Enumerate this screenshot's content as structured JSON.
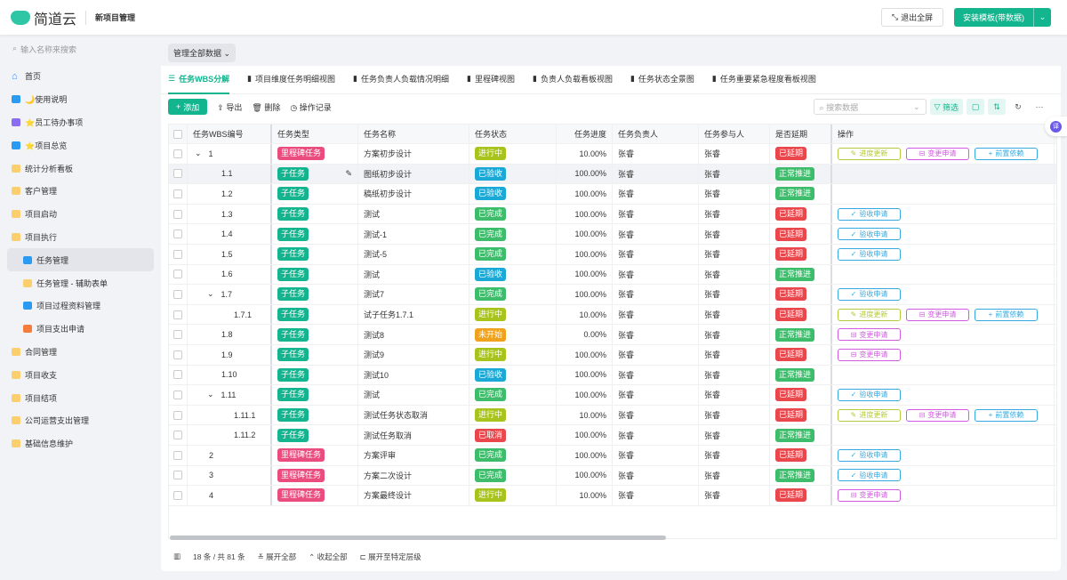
{
  "header": {
    "logo": "简道云",
    "app_title": "新项目管理",
    "exit_fullscreen": "退出全屏",
    "install": "安装模板(带数据)"
  },
  "sidebar": {
    "search_placeholder": "输入名称来搜索",
    "items": [
      {
        "label": "首页",
        "icon": "home",
        "level": 0
      },
      {
        "label": "🌙使用说明",
        "icon": "doc",
        "level": 0
      },
      {
        "label": "⭐员工待办事项",
        "icon": "chart",
        "level": 0
      },
      {
        "label": "⭐项目总览",
        "icon": "doc",
        "level": 0
      },
      {
        "label": "统计分析看板",
        "icon": "folder",
        "level": 0
      },
      {
        "label": "客户管理",
        "icon": "folder",
        "level": 0
      },
      {
        "label": "项目启动",
        "icon": "folder",
        "level": 0
      },
      {
        "label": "项目执行",
        "icon": "folder",
        "level": 0
      },
      {
        "label": "任务管理",
        "icon": "doc",
        "level": 1,
        "active": true
      },
      {
        "label": "任务管理 - 辅助表单",
        "icon": "folder",
        "level": 1
      },
      {
        "label": "项目过程资料管理",
        "icon": "doc",
        "level": 1
      },
      {
        "label": "项目支出申请",
        "icon": "orange",
        "level": 1
      },
      {
        "label": "合同管理",
        "icon": "folder",
        "level": 0
      },
      {
        "label": "项目收支",
        "icon": "folder",
        "level": 0
      },
      {
        "label": "项目结项",
        "icon": "folder",
        "level": 0
      },
      {
        "label": "公司运营支出管理",
        "icon": "folder",
        "level": 0
      },
      {
        "label": "基础信息维护",
        "icon": "folder",
        "level": 0
      }
    ]
  },
  "scope": "管理全部数据",
  "tabs": [
    "任务WBS分解",
    "项目维度任务明细视图",
    "任务负责人负载情况明细",
    "里程碑视图",
    "负责人负载看板视图",
    "任务状态全景图",
    "任务重要紧急程度看板视图"
  ],
  "toolbar": {
    "add": "添加",
    "export": "导出",
    "delete": "删除",
    "log": "操作记录",
    "search_placeholder": "搜索数据",
    "filter": "筛选"
  },
  "columns": [
    "任务WBS编号",
    "任务类型",
    "任务名称",
    "任务状态",
    "任务进度",
    "任务负责人",
    "任务参与人",
    "是否延期",
    "操作"
  ],
  "colors": {
    "里程碑任务": "#ea4c7e",
    "子任务": "#14b48e",
    "进行中": "#a8c41c",
    "已验收": "#1aa8d6",
    "已完成": "#3dbd6b",
    "未开始": "#f0a21c",
    "已取消": "#e9474c",
    "已延期": "#e9474c",
    "正常推进": "#3dbd6b"
  },
  "ops": {
    "进度更新": "#b5c93a",
    "变更申请": "#d25ae0",
    "前置依赖": "#35a9e0",
    "验收申请": "#35a9e0"
  },
  "rows": [
    {
      "wbs": "1",
      "lvl": 0,
      "exp": true,
      "type": "里程碑任务",
      "name": "方案初步设计",
      "status": "进行中",
      "progress": "10.00%",
      "owner": "张睿",
      "part": "张睿",
      "delay": "已延期",
      "ops": [
        "进度更新",
        "变更申请",
        "前置依赖"
      ]
    },
    {
      "wbs": "1.1",
      "lvl": 1,
      "type": "子任务",
      "name": "图纸初步设计",
      "status": "已验收",
      "progress": "100.00%",
      "owner": "张睿",
      "part": "张睿",
      "delay": "正常推进",
      "ops": []
    },
    {
      "wbs": "1.2",
      "lvl": 1,
      "type": "子任务",
      "name": "稿纸初步设计",
      "status": "已验收",
      "progress": "100.00%",
      "owner": "张睿",
      "part": "张睿",
      "delay": "正常推进",
      "ops": []
    },
    {
      "wbs": "1.3",
      "lvl": 1,
      "type": "子任务",
      "name": "测试",
      "status": "已完成",
      "progress": "100.00%",
      "owner": "张睿",
      "part": "张睿",
      "delay": "已延期",
      "ops": [
        "验收申请"
      ]
    },
    {
      "wbs": "1.4",
      "lvl": 1,
      "type": "子任务",
      "name": "测试-1",
      "status": "已完成",
      "progress": "100.00%",
      "owner": "张睿",
      "part": "张睿",
      "delay": "已延期",
      "ops": [
        "验收申请"
      ]
    },
    {
      "wbs": "1.5",
      "lvl": 1,
      "type": "子任务",
      "name": "测试-5",
      "status": "已完成",
      "progress": "100.00%",
      "owner": "张睿",
      "part": "张睿",
      "delay": "已延期",
      "ops": [
        "验收申请"
      ]
    },
    {
      "wbs": "1.6",
      "lvl": 1,
      "type": "子任务",
      "name": "测试",
      "status": "已验收",
      "progress": "100.00%",
      "owner": "张睿",
      "part": "张睿",
      "delay": "正常推进",
      "ops": []
    },
    {
      "wbs": "1.7",
      "lvl": 1,
      "exp": true,
      "type": "子任务",
      "name": "测试7",
      "status": "已完成",
      "progress": "100.00%",
      "owner": "张睿",
      "part": "张睿",
      "delay": "已延期",
      "ops": [
        "验收申请"
      ]
    },
    {
      "wbs": "1.7.1",
      "lvl": 2,
      "type": "子任务",
      "name": "试子任务1.7.1",
      "status": "进行中",
      "progress": "10.00%",
      "owner": "张睿",
      "part": "张睿",
      "delay": "已延期",
      "ops": [
        "进度更新",
        "变更申请",
        "前置依赖"
      ]
    },
    {
      "wbs": "1.8",
      "lvl": 1,
      "type": "子任务",
      "name": "测试8",
      "status": "未开始",
      "progress": "0.00%",
      "owner": "张睿",
      "part": "张睿",
      "delay": "正常推进",
      "ops": [
        "变更申请"
      ]
    },
    {
      "wbs": "1.9",
      "lvl": 1,
      "type": "子任务",
      "name": "测试9",
      "status": "进行中",
      "progress": "100.00%",
      "owner": "张睿",
      "part": "张睿",
      "delay": "已延期",
      "ops": [
        "变更申请"
      ]
    },
    {
      "wbs": "1.10",
      "lvl": 1,
      "type": "子任务",
      "name": "测试10",
      "status": "已验收",
      "progress": "100.00%",
      "owner": "张睿",
      "part": "张睿",
      "delay": "正常推进",
      "ops": []
    },
    {
      "wbs": "1.11",
      "lvl": 1,
      "exp": true,
      "type": "子任务",
      "name": "测试",
      "status": "已完成",
      "progress": "100.00%",
      "owner": "张睿",
      "part": "张睿",
      "delay": "已延期",
      "ops": [
        "验收申请"
      ]
    },
    {
      "wbs": "1.11.1",
      "lvl": 2,
      "type": "子任务",
      "name": "测试任务状态取消",
      "status": "进行中",
      "progress": "10.00%",
      "owner": "张睿",
      "part": "张睿",
      "delay": "已延期",
      "ops": [
        "进度更新",
        "变更申请",
        "前置依赖"
      ]
    },
    {
      "wbs": "1.11.2",
      "lvl": 2,
      "type": "子任务",
      "name": "测试任务取消",
      "status": "已取消",
      "progress": "100.00%",
      "owner": "张睿",
      "part": "张睿",
      "delay": "正常推进",
      "ops": []
    },
    {
      "wbs": "2",
      "lvl": 0,
      "type": "里程碑任务",
      "name": "方案评审",
      "status": "已完成",
      "progress": "100.00%",
      "owner": "张睿",
      "part": "张睿",
      "delay": "已延期",
      "ops": [
        "验收申请"
      ]
    },
    {
      "wbs": "3",
      "lvl": 0,
      "type": "里程碑任务",
      "name": "方案二次设计",
      "status": "已完成",
      "progress": "100.00%",
      "owner": "张睿",
      "part": "张睿",
      "delay": "正常推进",
      "ops": [
        "验收申请"
      ]
    },
    {
      "wbs": "4",
      "lvl": 0,
      "type": "里程碑任务",
      "name": "方案最终设计",
      "status": "进行中",
      "progress": "10.00%",
      "owner": "张睿",
      "part": "张睿",
      "delay": "已延期",
      "ops": [
        "变更申请"
      ]
    }
  ],
  "footer": {
    "count": "18 条 / 共 81 条",
    "expand_all": "展开全部",
    "collapse_all": "收起全部",
    "expand_level": "展开至特定层级"
  },
  "translate": "译"
}
